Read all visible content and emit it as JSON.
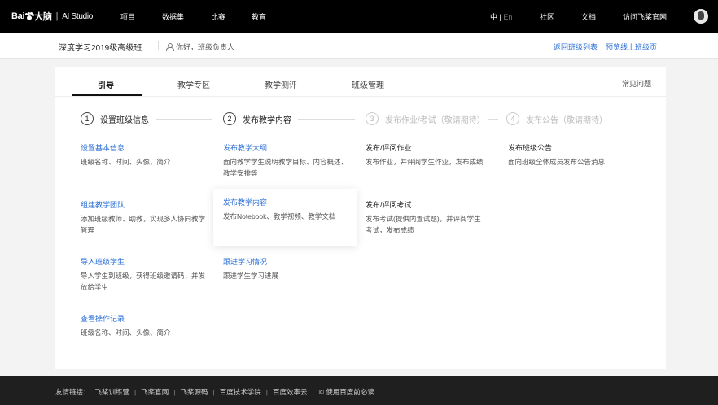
{
  "topnav": {
    "logo_brand": "Bai",
    "logo_brand2": "大脑",
    "logo_product": "AI Studio",
    "items": [
      "项目",
      "数据集",
      "比赛",
      "教育"
    ],
    "lang_zh": "中",
    "lang_sep": "|",
    "lang_en": "En",
    "right_items": [
      "社区",
      "文档",
      "访问飞桨官网"
    ]
  },
  "subheader": {
    "class_name": "深度学习2019级高级班",
    "greeting": "你好，班级负责人",
    "back_link": "返回班级列表",
    "preview_link": "预览线上班级页"
  },
  "tabs": [
    "引导",
    "教学专区",
    "教学测评",
    "班级管理"
  ],
  "faq": "常见问题",
  "steps": [
    {
      "num": "1",
      "label": "设置班级信息"
    },
    {
      "num": "2",
      "label": "发布教学内容"
    },
    {
      "num": "3",
      "label": "发布作业/考试（敬请期待）"
    },
    {
      "num": "4",
      "label": "发布公告（敬请期待）"
    }
  ],
  "columns": [
    [
      {
        "title": "设置基本信息",
        "desc": "班级名称、时间、头像、简介"
      },
      {
        "title": "组建教学团队",
        "desc": "添加班级教师、助教，实现多人协同教学管理"
      },
      {
        "title": "导入班级学生",
        "desc": "导入学生到班级，获得班级邀请码，并发放给学生"
      },
      {
        "title": "查看操作记录",
        "desc": "班级名称、时间、头像、简介"
      }
    ],
    [
      {
        "title": "发布教学大纲",
        "desc": "面向教学学生说明教学目标、内容概述、教学安排等"
      },
      {
        "title": "发布教学内容",
        "desc": "发布Notebook、教学视频、教学文档"
      },
      {
        "title": "跟进学习情况",
        "desc": "跟进学生学习进展"
      }
    ],
    [
      {
        "title": "发布/评阅作业",
        "desc": "发布作业，并评阅学生作业，发布成绩"
      },
      {
        "title": "发布/评阅考试",
        "desc": "发布考试(提供内置试题)，并评阅学生考试，发布成绩"
      }
    ],
    [
      {
        "title": "发布班级公告",
        "desc": "面向班级全体成员发布公告消息"
      }
    ]
  ],
  "footer": {
    "label": "友情链接：",
    "links": [
      "飞桨训练营",
      "飞桨官网",
      "飞桨源码",
      "百度技术学院",
      "百度效率云",
      "© 使用百度前必读"
    ],
    "separator": "|"
  },
  "colors": {
    "link": "#2b6fd6",
    "topbar": "#000000",
    "footer": "#1f1f1f"
  }
}
